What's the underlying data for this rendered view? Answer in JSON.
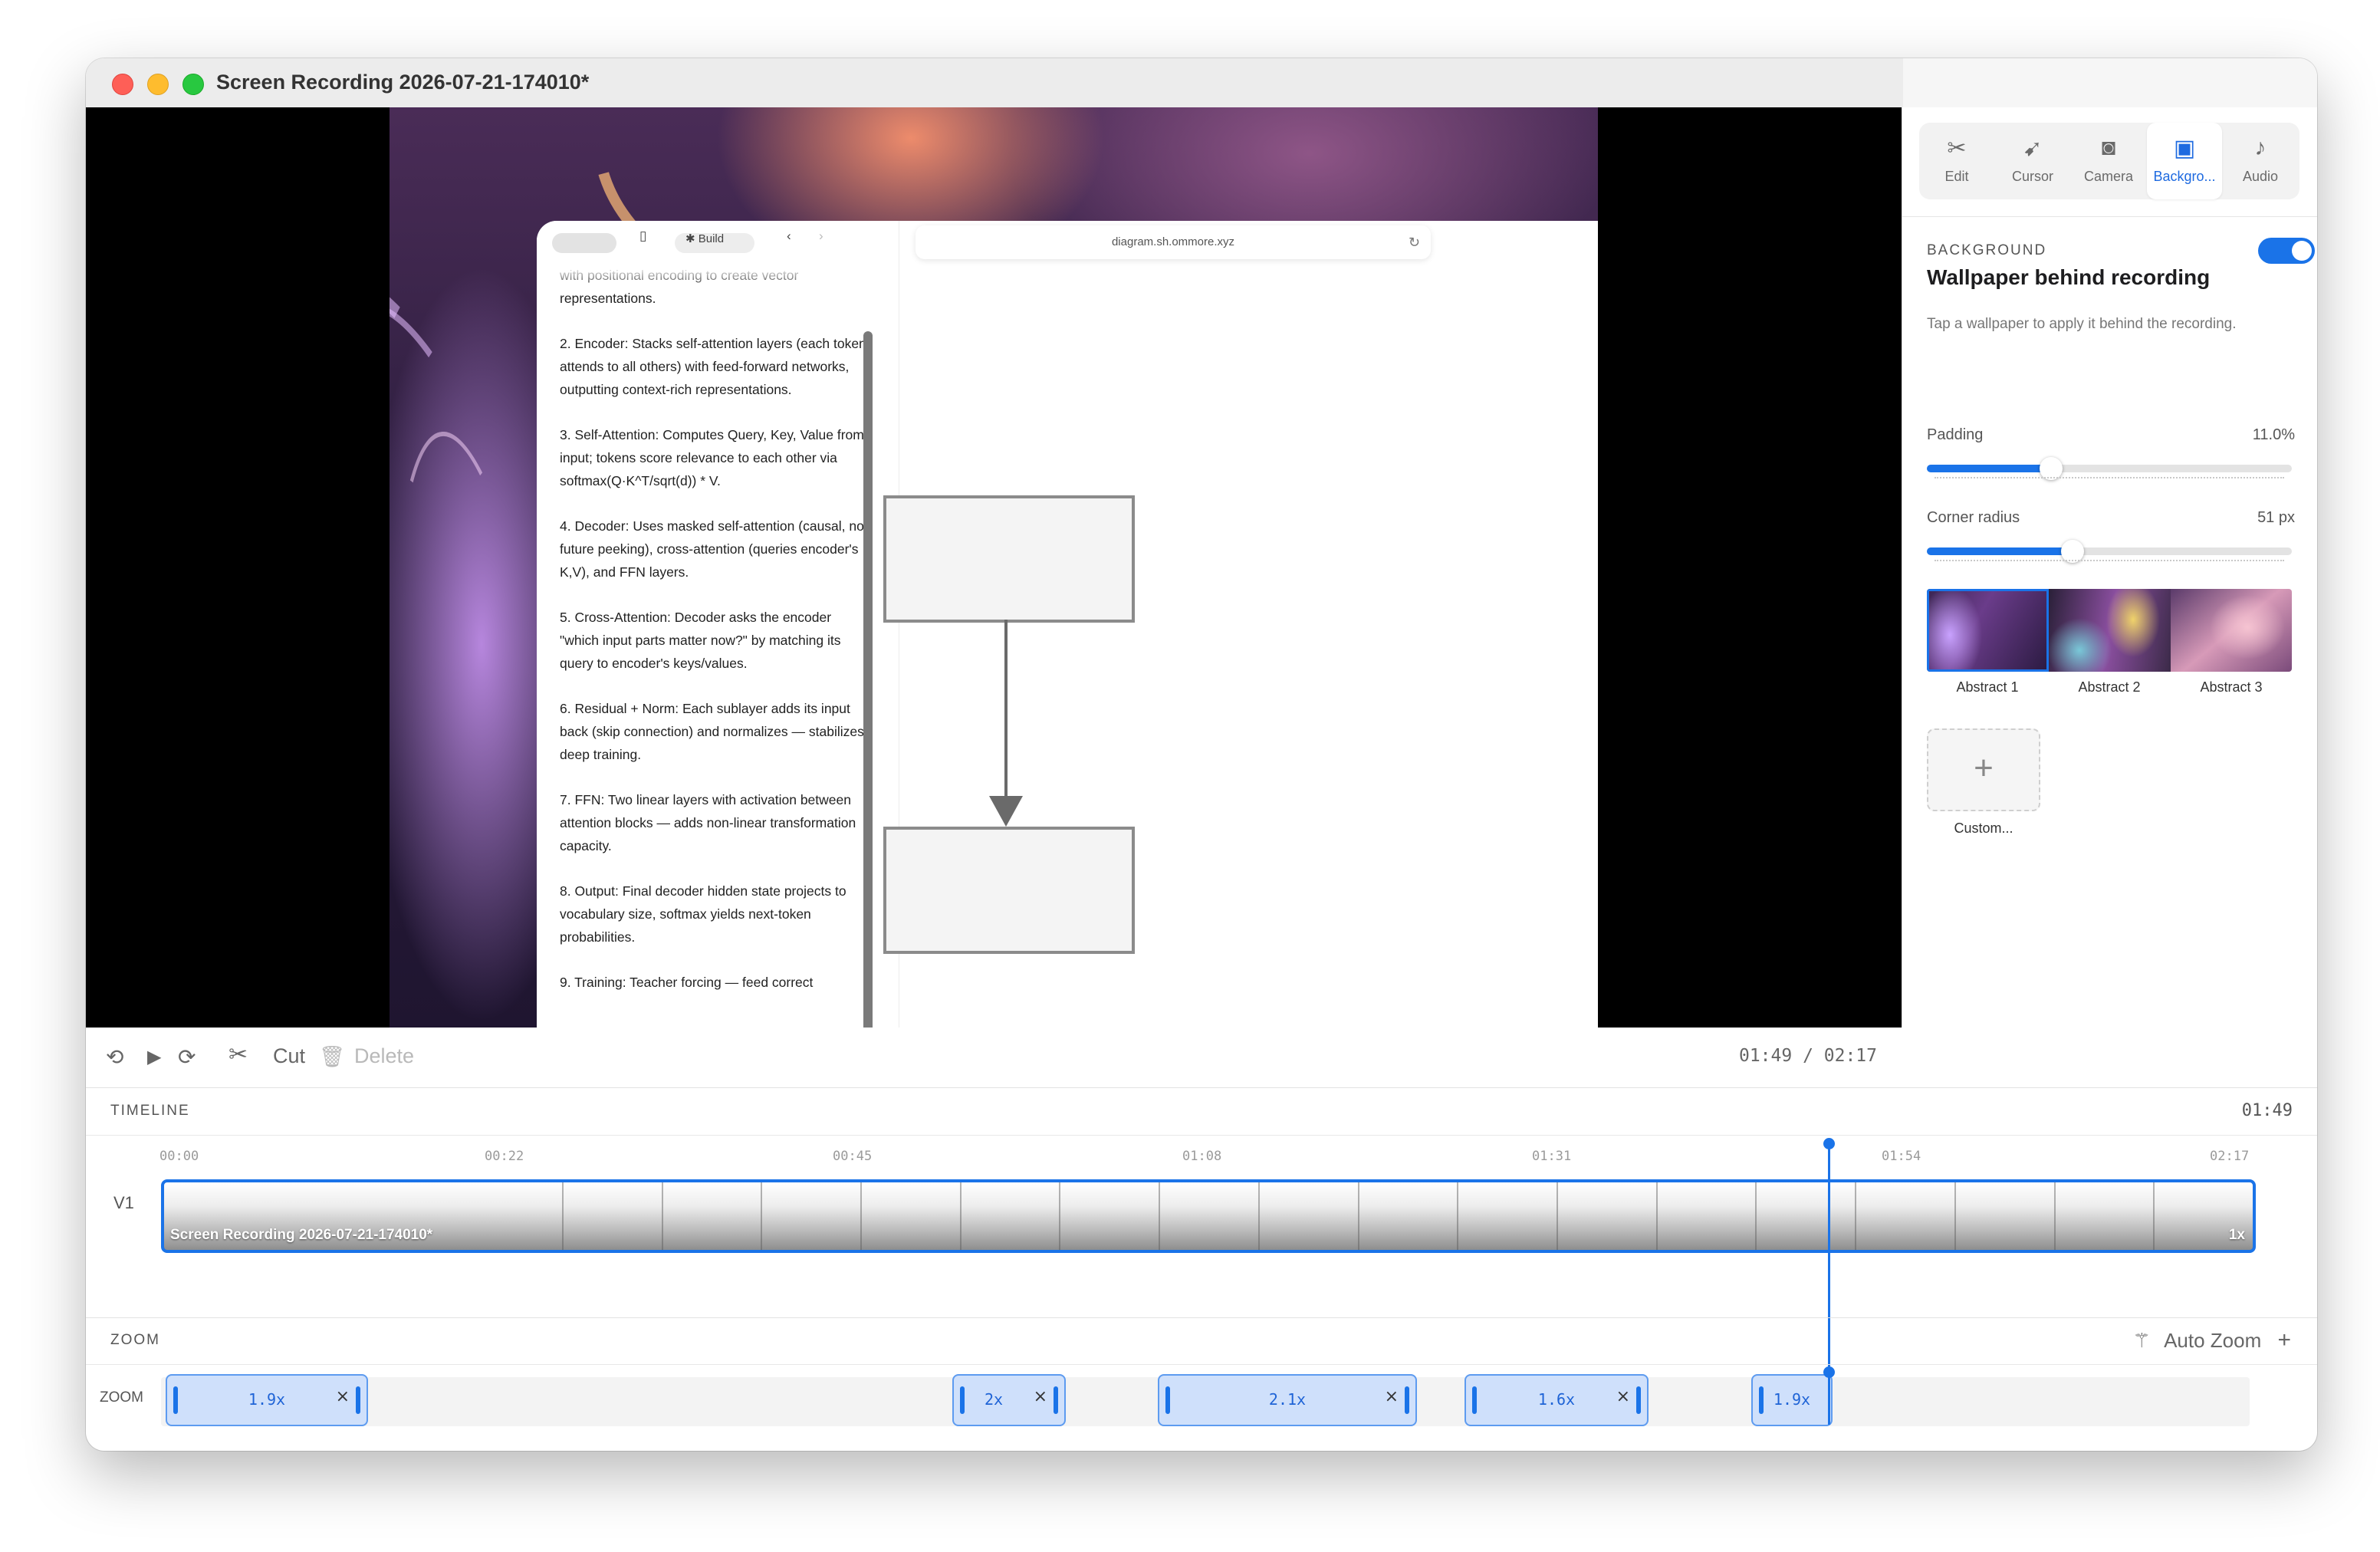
{
  "window": {
    "title": "Screen Recording 2026-07-21-174010*"
  },
  "preview": {
    "inner_browser": {
      "build_label": "✱ Build",
      "url": "diagram.sh.ommore.xyz",
      "doc_paragraphs": [
        "with positional encoding to create vector representations.",
        "2. Encoder: Stacks self-attention layers (each token attends to all others) with feed-forward networks, outputting context-rich representations.",
        "3. Self-Attention: Computes Query, Key, Value from input; tokens score relevance to each other via softmax(Q·K^T/sqrt(d)) * V.",
        "4. Decoder: Uses masked self-attention (causal, no future peeking), cross-attention (queries encoder's K,V), and FFN layers.",
        "5. Cross-Attention: Decoder asks the encoder \"which input parts matter now?\" by matching its query to encoder's keys/values.",
        "6. Residual + Norm: Each sublayer adds its input back (skip connection) and normalizes — stabilizes deep training.",
        "7. FFN: Two linear layers with activation between attention blocks — adds non-linear transformation capacity.",
        "8. Output: Final decoder hidden state projects to vocabulary size, softmax yields next-token probabilities.",
        "9. Training: Teacher forcing — feed correct"
      ]
    }
  },
  "controls": {
    "back_icon": "rewind-10-icon",
    "play_icon": "play-icon",
    "forward_icon": "forward-10-icon",
    "cut_label": "Cut",
    "delete_label": "Delete",
    "timecode": "01:49 / 02:17"
  },
  "sidebar": {
    "tabs": [
      {
        "label": "Edit",
        "icon": "scissors-icon"
      },
      {
        "label": "Cursor",
        "icon": "cursor-icon"
      },
      {
        "label": "Camera",
        "icon": "camera-icon"
      },
      {
        "label": "Backgro...",
        "icon": "image-icon",
        "active": true
      },
      {
        "label": "Audio",
        "icon": "music-note-icon"
      }
    ],
    "section_label": "BACKGROUND",
    "section_title": "Wallpaper behind recording",
    "toggle_on": true,
    "hint": "Tap a wallpaper to apply it behind the recording.",
    "padding": {
      "label": "Padding",
      "value": "11.0%",
      "fraction": 0.34
    },
    "corner_radius": {
      "label": "Corner radius",
      "value": "51 px",
      "fraction": 0.4
    },
    "wallpapers": [
      "Abstract 1",
      "Abstract 2",
      "Abstract 3"
    ],
    "custom_label": "Custom...",
    "custom_plus": "+"
  },
  "timeline": {
    "label": "TIMELINE",
    "current_time": "01:49",
    "ruler": [
      "00:00",
      "00:22",
      "00:45",
      "01:08",
      "01:31",
      "01:54",
      "02:17"
    ],
    "track_label": "V1",
    "clip_name": "Screen Recording 2026-07-21-174010*",
    "clip_speed": "1x"
  },
  "zoom": {
    "label": "ZOOM",
    "auto_zoom_label": "Auto Zoom",
    "add_label": "+",
    "row_label": "ZOOM",
    "segments": [
      {
        "value": "1.9x"
      },
      {
        "value": "2x"
      },
      {
        "value": "2.1x"
      },
      {
        "value": "1.6x"
      },
      {
        "value": "1.9x"
      }
    ],
    "close_glyph": "×"
  },
  "colors": {
    "accent": "#1a73e8",
    "close": "#fe5f57",
    "minimize": "#febc2e",
    "maximize": "#28c840"
  }
}
